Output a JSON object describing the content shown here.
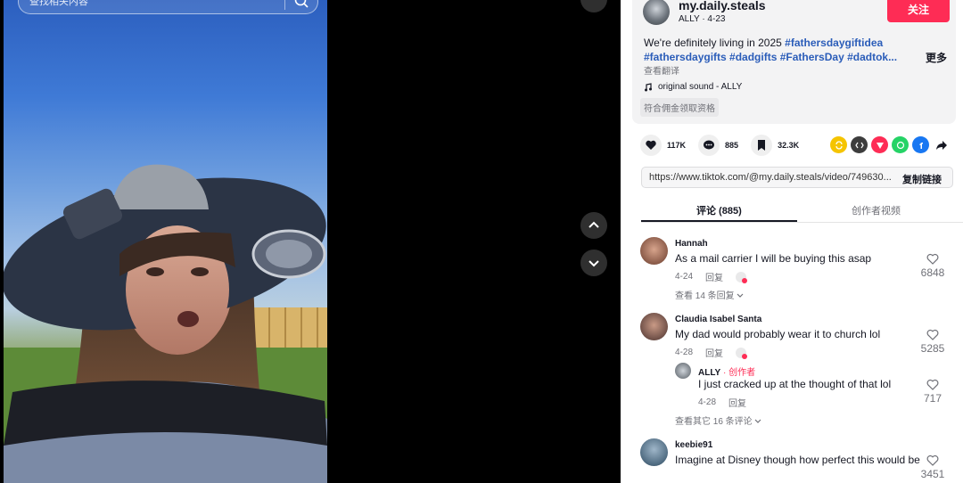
{
  "search": {
    "placeholder": "查找相关内容"
  },
  "video": {},
  "author": {
    "username": "my.daily.steals",
    "display_line": "ALLY · 4-23",
    "follow_label": "关注"
  },
  "description": {
    "line1_text": "We're definitely living in 2025 ",
    "line1_tag": "#fathersdaygiftidea",
    "line2_tags": "#fathersdaygifts #dadgifts #FathersDay #dadtok...",
    "more_label": "更多",
    "translate_label": "查看翻译",
    "sound": "original sound - ALLY",
    "eligible_label": "符合佣金领取资格"
  },
  "stats": {
    "likes": "117K",
    "comments": "885",
    "saves": "32.3K"
  },
  "share_icons": [
    "repost-icon",
    "embed-icon",
    "send-icon",
    "whatsapp-icon",
    "facebook-icon",
    "share-arrow-icon"
  ],
  "colors": {
    "accent": "#fe2c55",
    "hashtag": "#2b5db9"
  },
  "link": {
    "url": "https://www.tiktok.com/@my.daily.steals/video/749630...",
    "copy_label": "复制链接"
  },
  "tabs": {
    "comments_label": "评论 (885)",
    "creator_videos_label": "创作者视频"
  },
  "comments": [
    {
      "name": "Hannah",
      "text": "As a mail carrier I will be buying this asap",
      "date": "4-24",
      "reply_label": "回复",
      "likes": "6848",
      "view_more": "查看 14 条回复"
    },
    {
      "name": "Claudia Isabel Santa",
      "text": "My dad would probably wear it to church lol",
      "date": "4-28",
      "reply_label": "回复",
      "likes": "5285",
      "reply": {
        "name": "ALLY",
        "creator_tag": " · 创作者",
        "text": "I just cracked up at the thought of that lol",
        "date": "4-28",
        "reply_label": "回复",
        "likes": "717"
      },
      "view_more": "查看其它 16 条评论"
    },
    {
      "name": "keebie91",
      "text": "Imagine at Disney though how perfect this would be",
      "likes": "3451"
    }
  ]
}
